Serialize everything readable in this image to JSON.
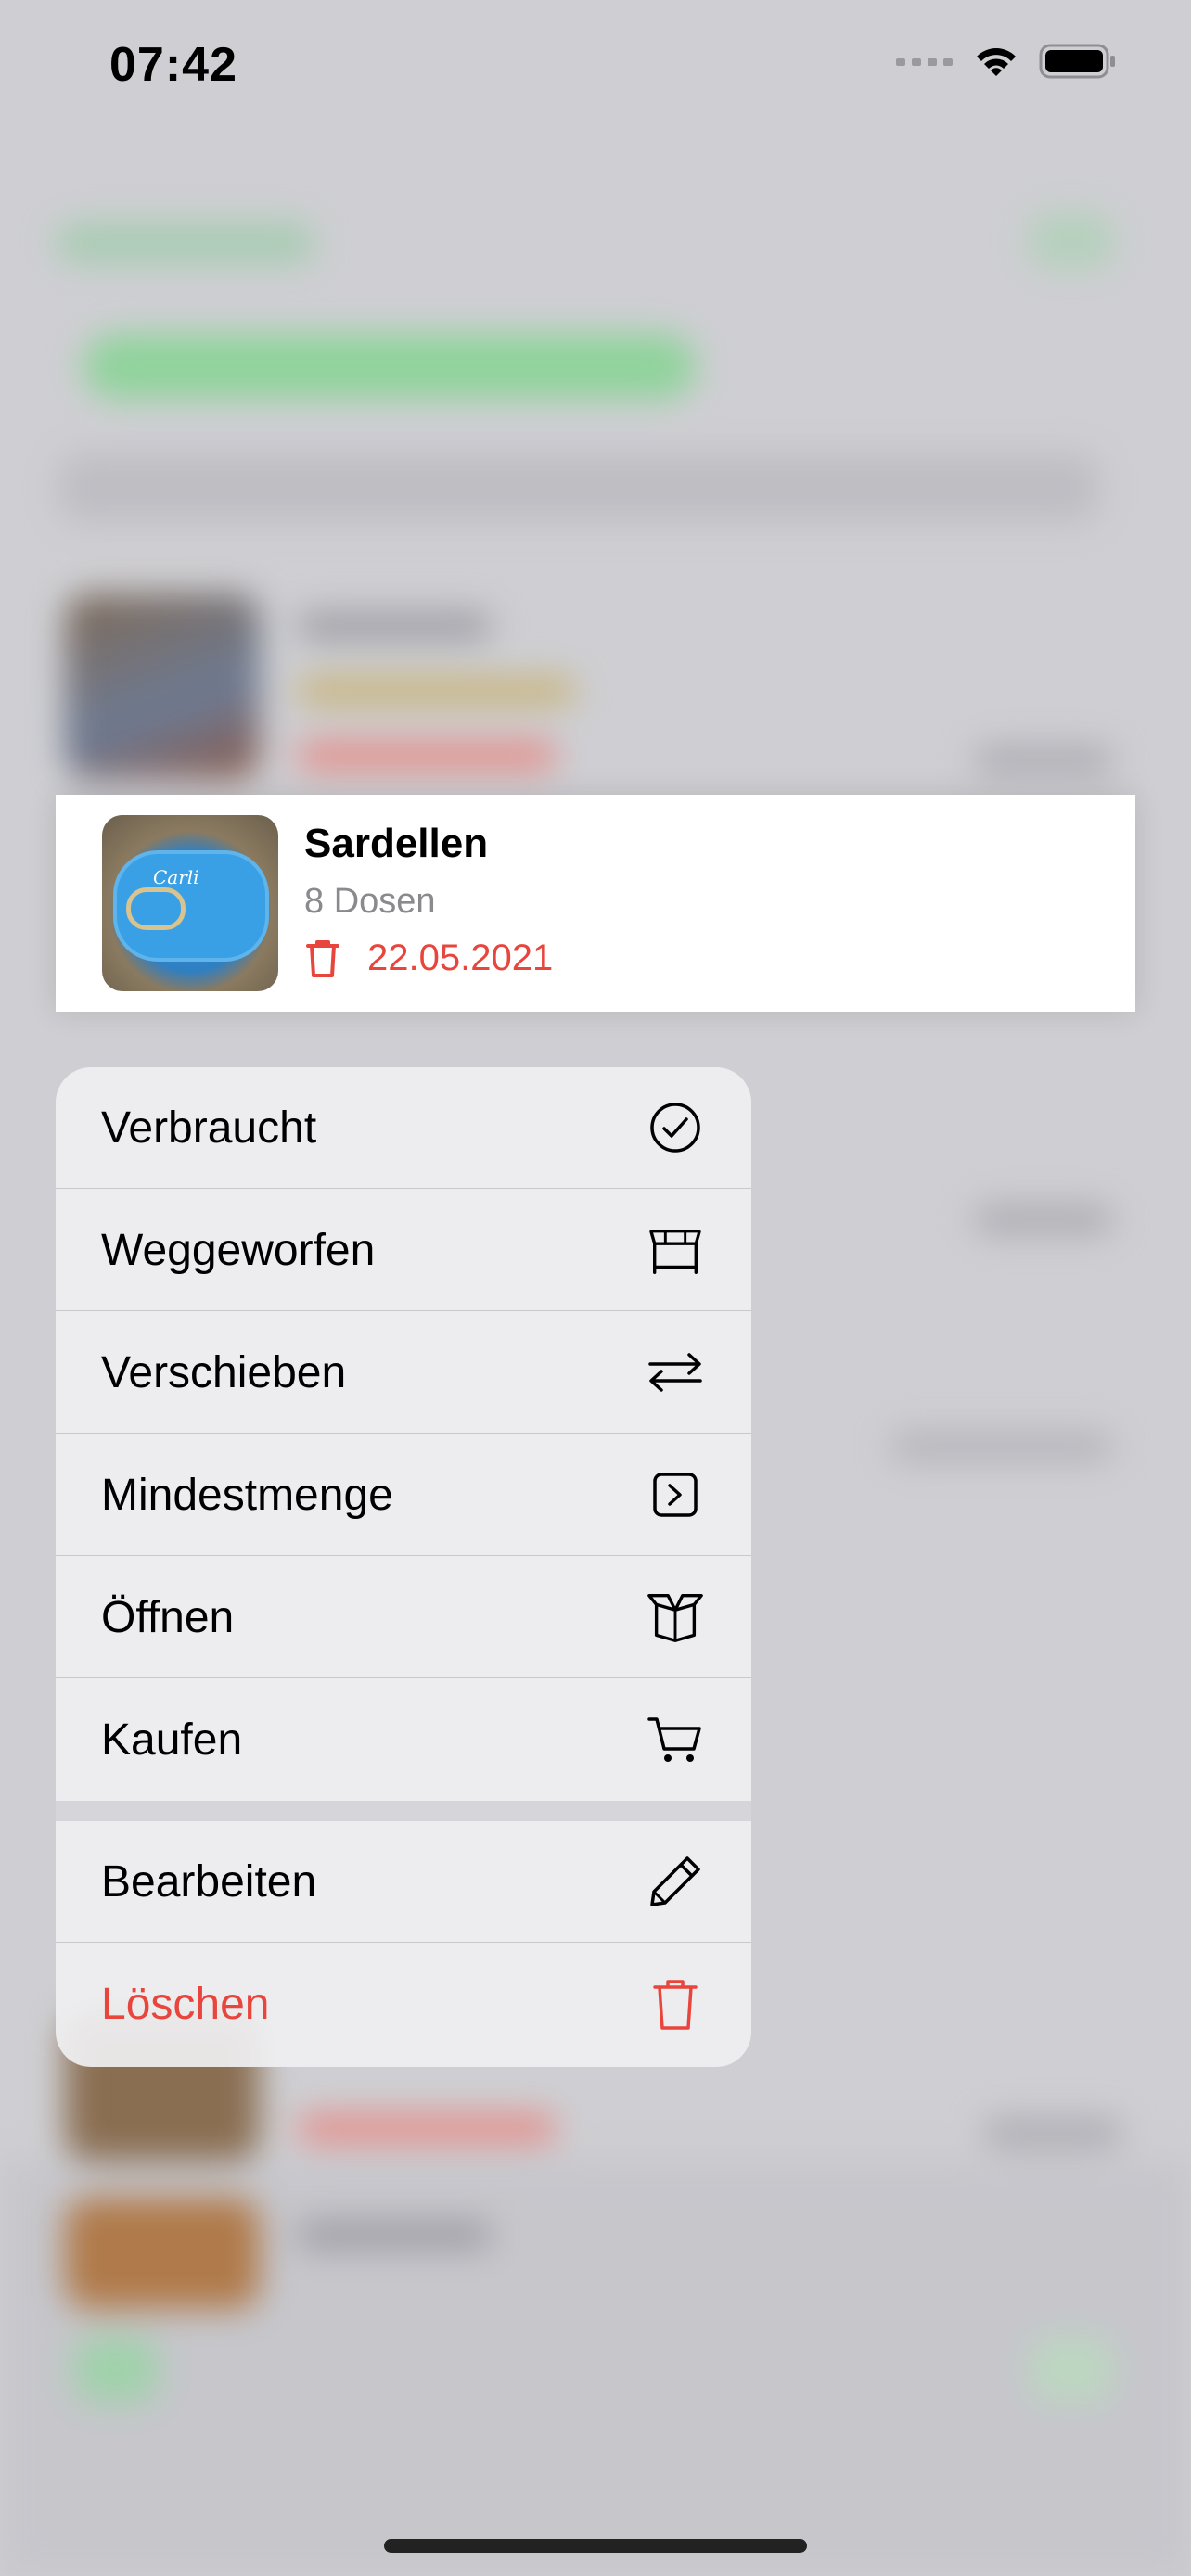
{
  "status_bar": {
    "time": "07:42"
  },
  "preview": {
    "title": "Sardellen",
    "quantity": "8 Dosen",
    "date": "22.05.2021",
    "date_icon": "trash-icon",
    "thumbnail": "sardine-tin-photo"
  },
  "menu": {
    "items": [
      {
        "label": "Verbraucht",
        "icon": "checkmark-circle-icon"
      },
      {
        "label": "Weggeworfen",
        "icon": "dumpster-icon"
      },
      {
        "label": "Verschieben",
        "icon": "arrows-swap-icon"
      },
      {
        "label": "Mindestmenge",
        "icon": "square-chevron-right-icon"
      },
      {
        "label": "Öffnen",
        "icon": "open-box-icon"
      },
      {
        "label": "Kaufen",
        "icon": "cart-icon"
      },
      {
        "label": "Bearbeiten",
        "icon": "pencil-icon"
      },
      {
        "label": "Löschen",
        "icon": "trash-icon"
      }
    ]
  },
  "colors": {
    "destructive": "#e8453c",
    "accent": "#8fd39b"
  }
}
